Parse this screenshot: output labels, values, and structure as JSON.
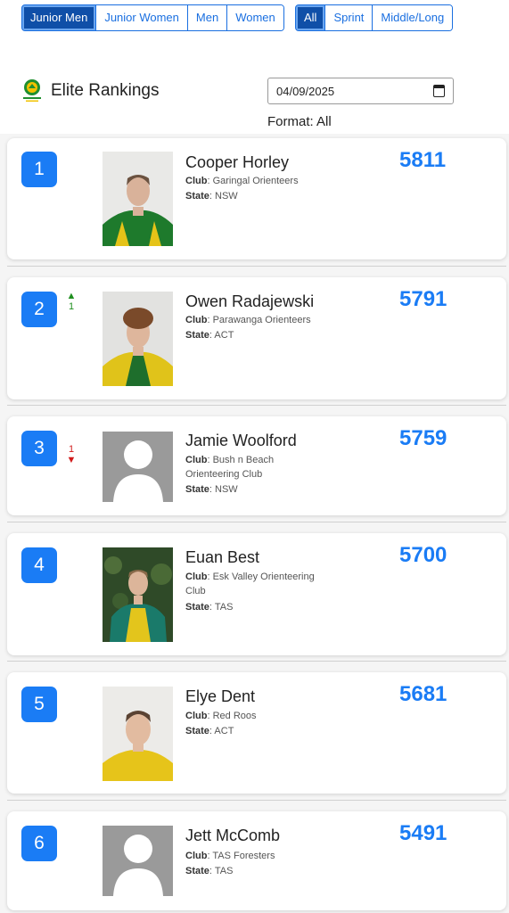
{
  "category_filters": [
    {
      "label": "Junior Men",
      "active": true
    },
    {
      "label": "Junior Women",
      "active": false
    },
    {
      "label": "Men",
      "active": false
    },
    {
      "label": "Women",
      "active": false
    }
  ],
  "format_filters": [
    {
      "label": "All",
      "active": true
    },
    {
      "label": "Sprint",
      "active": false
    },
    {
      "label": "Middle/Long",
      "active": false
    }
  ],
  "header": {
    "title": "Elite Rankings",
    "date_value": "04/09/2025",
    "format_label": "Format: All"
  },
  "labels": {
    "club": "Club",
    "state": "State"
  },
  "athletes": [
    {
      "rank": "1",
      "movement": null,
      "name": "Cooper Horley",
      "club": "Garingal Orienteers",
      "state": "NSW",
      "points": "5811",
      "photo": "photo"
    },
    {
      "rank": "2",
      "movement": {
        "direction": "up",
        "amount": "1"
      },
      "name": "Owen Radajewski",
      "club": "Parawanga Orienteers",
      "state": "ACT",
      "points": "5791",
      "photo": "photo"
    },
    {
      "rank": "3",
      "movement": {
        "direction": "down",
        "amount": "1"
      },
      "name": "Jamie Woolford",
      "club": "Bush n Beach Orienteering Club",
      "state": "NSW",
      "points": "5759",
      "photo": "placeholder"
    },
    {
      "rank": "4",
      "movement": null,
      "name": "Euan Best",
      "club": "Esk Valley Orienteering Club",
      "state": "TAS",
      "points": "5700",
      "photo": "photo"
    },
    {
      "rank": "5",
      "movement": null,
      "name": "Elye Dent",
      "club": "Red Roos",
      "state": "ACT",
      "points": "5681",
      "photo": "photo"
    },
    {
      "rank": "6",
      "movement": null,
      "name": "Jett McComb",
      "club": "TAS Foresters",
      "state": "TAS",
      "points": "5491",
      "photo": "placeholder"
    }
  ],
  "colors": {
    "accent": "#1a7cf5",
    "active_button": "#0f4fa8",
    "up": "#1f8f1f",
    "down": "#d11a1a"
  }
}
